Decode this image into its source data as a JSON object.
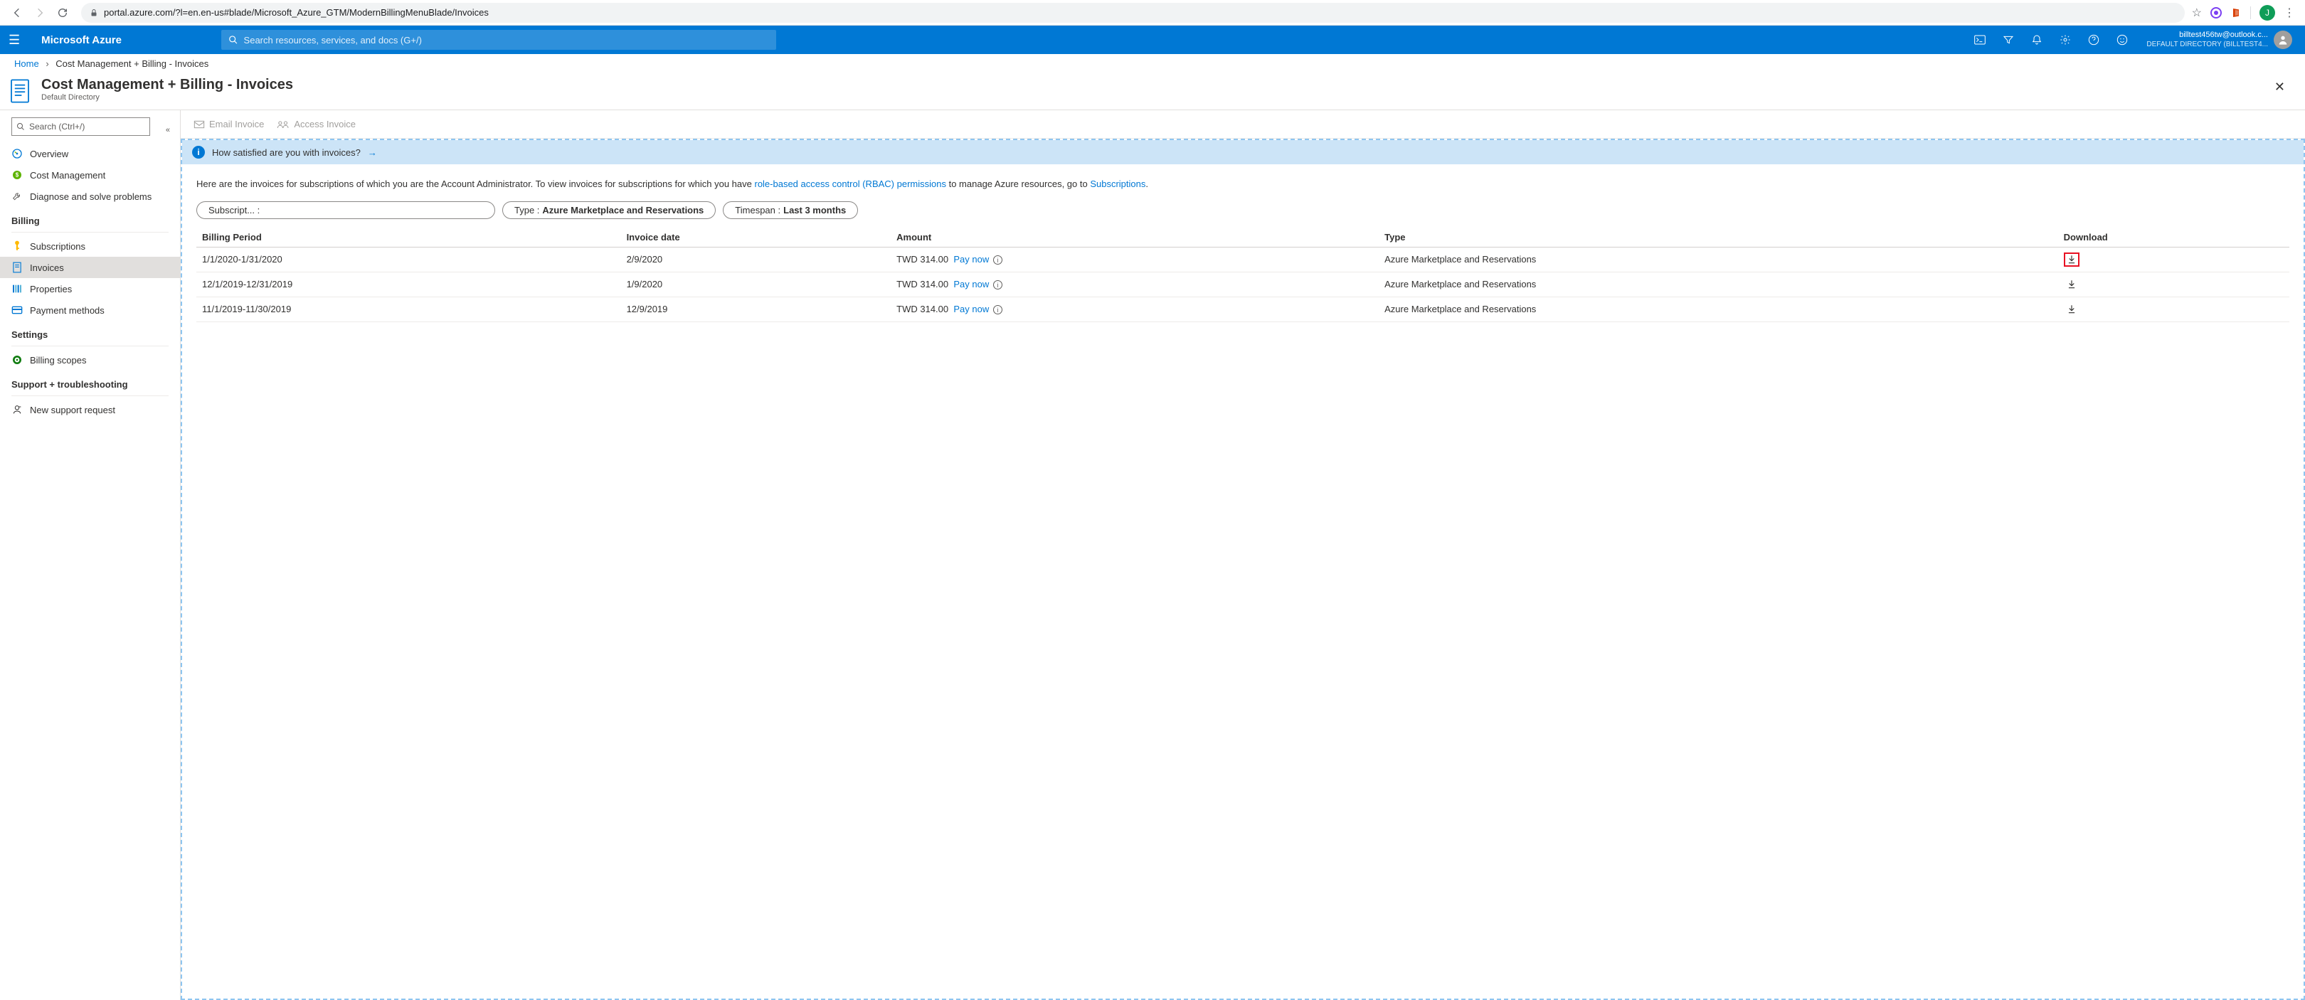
{
  "browser": {
    "url": "portal.azure.com/?l=en.en-us#blade/Microsoft_Azure_GTM/ModernBillingMenuBlade/Invoices",
    "avatar_letter": "J"
  },
  "azure": {
    "brand": "Microsoft Azure",
    "search_placeholder": "Search resources, services, and docs (G+/)",
    "user_email": "billtest456tw@outlook.c...",
    "user_dir": "DEFAULT DIRECTORY (BILLTEST4..."
  },
  "breadcrumb": {
    "home": "Home",
    "current": "Cost Management + Billing - Invoices"
  },
  "blade": {
    "title": "Cost Management + Billing - Invoices",
    "subtitle": "Default Directory"
  },
  "sidebar": {
    "search_placeholder": "Search (Ctrl+/)",
    "items_top": [
      {
        "label": "Overview"
      },
      {
        "label": "Cost Management"
      },
      {
        "label": "Diagnose and solve problems"
      }
    ],
    "section_billing": "Billing",
    "items_billing": [
      {
        "label": "Subscriptions"
      },
      {
        "label": "Invoices"
      },
      {
        "label": "Properties"
      },
      {
        "label": "Payment methods"
      }
    ],
    "section_settings": "Settings",
    "items_settings": [
      {
        "label": "Billing scopes"
      }
    ],
    "section_support": "Support + troubleshooting",
    "items_support": [
      {
        "label": "New support request"
      }
    ]
  },
  "commands": {
    "email": "Email Invoice",
    "access": "Access Invoice"
  },
  "banner": {
    "text": "How satisfied are you with invoices?"
  },
  "description": {
    "pre": "Here are the invoices for subscriptions of which you are the Account Administrator. To view invoices for subscriptions for which you have ",
    "link1": "role-based access control (RBAC) permissions",
    "mid": " to manage Azure resources, go to ",
    "link2": "Subscriptions",
    "post": "."
  },
  "filters": {
    "f1": "Subscript... :",
    "f2_label": "Type : ",
    "f2_value": "Azure Marketplace and Reservations",
    "f3_label": "Timespan : ",
    "f3_value": "Last 3 months"
  },
  "table": {
    "headers": {
      "period": "Billing Period",
      "date": "Invoice date",
      "amount": "Amount",
      "type": "Type",
      "download": "Download"
    },
    "paynow": "Pay now",
    "rows": [
      {
        "period": "1/1/2020-1/31/2020",
        "date": "2/9/2020",
        "amount": "TWD 314.00",
        "type": "Azure Marketplace and Reservations",
        "hilite": true
      },
      {
        "period": "12/1/2019-12/31/2019",
        "date": "1/9/2020",
        "amount": "TWD 314.00",
        "type": "Azure Marketplace and Reservations",
        "hilite": false
      },
      {
        "period": "11/1/2019-11/30/2019",
        "date": "12/9/2019",
        "amount": "TWD 314.00",
        "type": "Azure Marketplace and Reservations",
        "hilite": false
      }
    ]
  }
}
